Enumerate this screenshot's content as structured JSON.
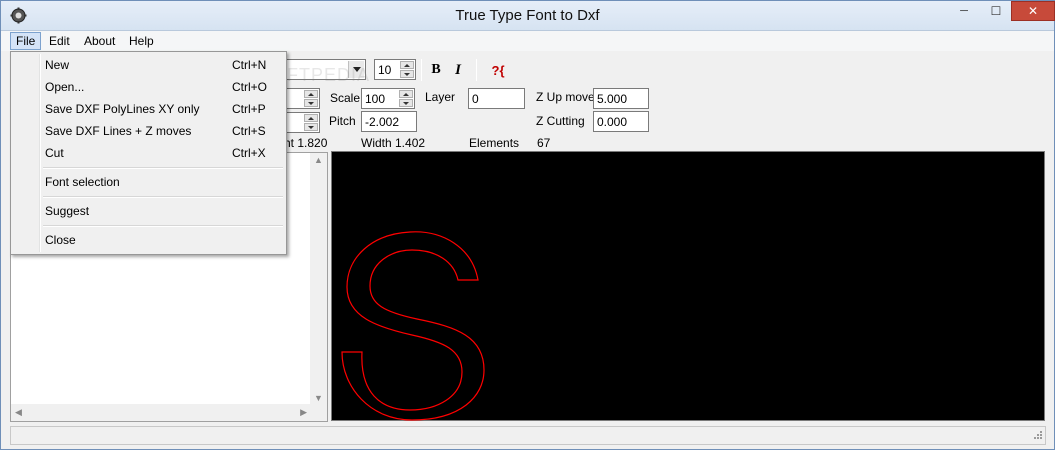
{
  "window": {
    "title": "True Type Font to Dxf",
    "minimize_glyph": "─",
    "maximize_glyph": "☐",
    "close_glyph": "✕"
  },
  "menubar": [
    {
      "label": "File"
    },
    {
      "label": "Edit"
    },
    {
      "label": "About"
    },
    {
      "label": "Help"
    }
  ],
  "file_menu": {
    "items": [
      {
        "label": "New",
        "shortcut": "Ctrl+N"
      },
      {
        "label": "Open...",
        "shortcut": "Ctrl+O"
      },
      {
        "label": "Save DXF PolyLines XY only",
        "shortcut": "Ctrl+P"
      },
      {
        "label": "Save DXF Lines + Z moves",
        "shortcut": "Ctrl+S"
      },
      {
        "label": "Cut",
        "shortcut": "Ctrl+X"
      },
      {
        "label": "Font selection",
        "shortcut": ""
      },
      {
        "label": "Suggest",
        "shortcut": ""
      },
      {
        "label": "Close",
        "shortcut": ""
      }
    ]
  },
  "toolbar": {
    "font_size": "10",
    "bold_label": "B",
    "italic_label": "I",
    "help_label": "?{",
    "scale_label": "Scale",
    "scale_value": "100",
    "pitch_label": "Pitch",
    "pitch_value": "-2.002",
    "layer_label": "Layer",
    "layer_value": "0",
    "z_up_label": "Z Up move",
    "z_up_value": "5.000",
    "z_cut_label": "Z Cutting",
    "z_cut_value": "0.000"
  },
  "info": {
    "height_text": "ht  1.820",
    "width_text": "Width  1.402",
    "elements_label": "Elements",
    "elements_value": "67"
  },
  "canvas": {
    "background": "#000000",
    "glyph_color": "#ff0000"
  },
  "watermark": "SOFTPEDIA"
}
